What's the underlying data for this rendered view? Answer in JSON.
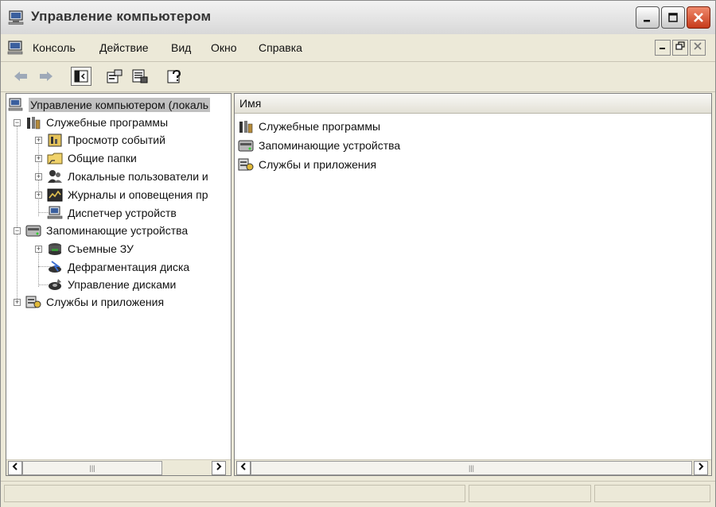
{
  "window": {
    "title": "Управление компьютером"
  },
  "menubar": {
    "items": [
      "Консоль",
      "Действие",
      "Вид",
      "Окно",
      "Справка"
    ]
  },
  "toolbar": {
    "icons": [
      "back-arrow-icon",
      "forward-arrow-icon",
      "show-hide-tree-icon",
      "properties-icon",
      "export-list-icon",
      "help-icon"
    ]
  },
  "tree": {
    "root": "Управление компьютером (локаль",
    "system_tools": "Служебные программы",
    "event_viewer": "Просмотр событий",
    "shared_folders": "Общие папки",
    "local_users": "Локальные пользователи и",
    "logs_alerts": "Журналы и оповещения пр",
    "device_manager": "Диспетчер устройств",
    "storage": "Запоминающие устройства",
    "removable": "Съемные ЗУ",
    "defrag": "Дефрагментация диска",
    "disk_mgmt": "Управление дисками",
    "services_apps": "Службы и приложения"
  },
  "list": {
    "column_name": "Имя",
    "items": [
      "Служебные программы",
      "Запоминающие устройства",
      "Службы и приложения"
    ]
  },
  "colors": {
    "chrome": "#ece9d8",
    "close": "#c63a1b",
    "selection": "#c0c0c0"
  }
}
